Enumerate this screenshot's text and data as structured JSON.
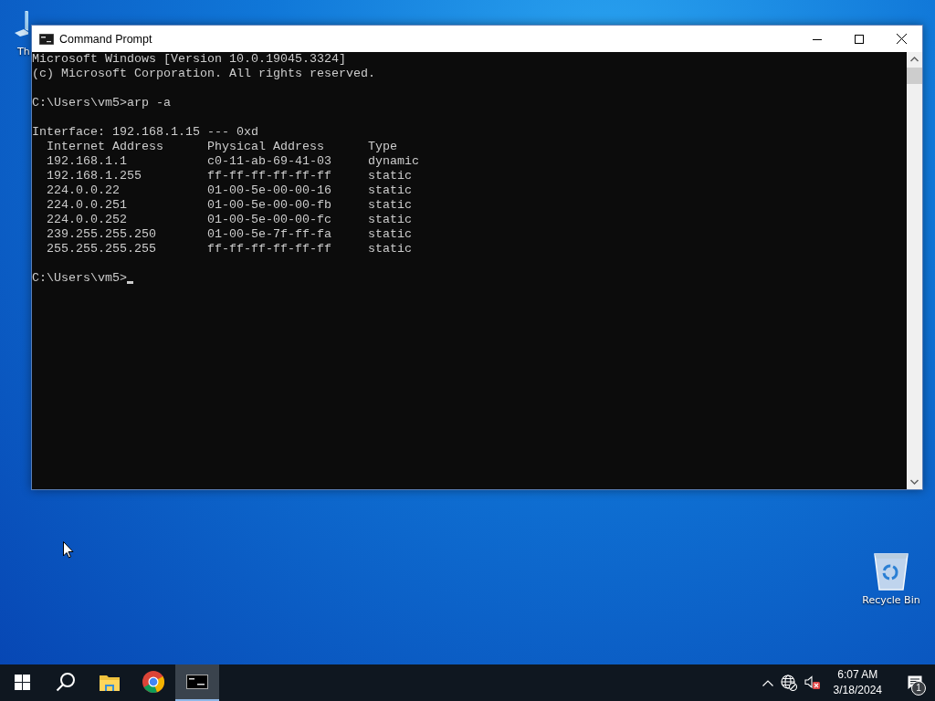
{
  "desktop_icons": [
    {
      "kind": "shortcut",
      "label": "Th"
    },
    {
      "kind": "recycle_bin",
      "label": "Recycle Bin"
    }
  ],
  "window": {
    "title": "Command Prompt"
  },
  "console": {
    "blocks": [
      [
        "Microsoft Windows [Version 10.0.19045.3324]",
        "(c) Microsoft Corporation. All rights reserved."
      ],
      [
        "C:\\Users\\vm5>arp -a"
      ],
      [
        "Interface: 192.168.1.15 --- 0xd",
        "  Internet Address      Physical Address      Type",
        "  192.168.1.1           c0-11-ab-69-41-03     dynamic",
        "  192.168.1.255         ff-ff-ff-ff-ff-ff     static",
        "  224.0.0.22            01-00-5e-00-00-16     static",
        "  224.0.0.251           01-00-5e-00-00-fb     static",
        "  224.0.0.252           01-00-5e-00-00-fc     static",
        "  239.255.255.250       01-00-5e-7f-ff-fa     static",
        "  255.255.255.255       ff-ff-ff-ff-ff-ff     static"
      ],
      [
        "C:\\Users\\vm5>"
      ]
    ],
    "cursor": true
  },
  "taskbar": {
    "items": [
      {
        "kind": "start",
        "selected": false
      },
      {
        "kind": "search",
        "selected": false
      },
      {
        "kind": "folder",
        "selected": false
      },
      {
        "kind": "browser",
        "selected": false
      },
      {
        "kind": "terminal",
        "selected": true
      }
    ],
    "network": {
      "connected": false
    },
    "volume": {
      "muted": true
    },
    "time": "6:07 AM",
    "date": "3/18/2024",
    "notification_count": "1"
  }
}
